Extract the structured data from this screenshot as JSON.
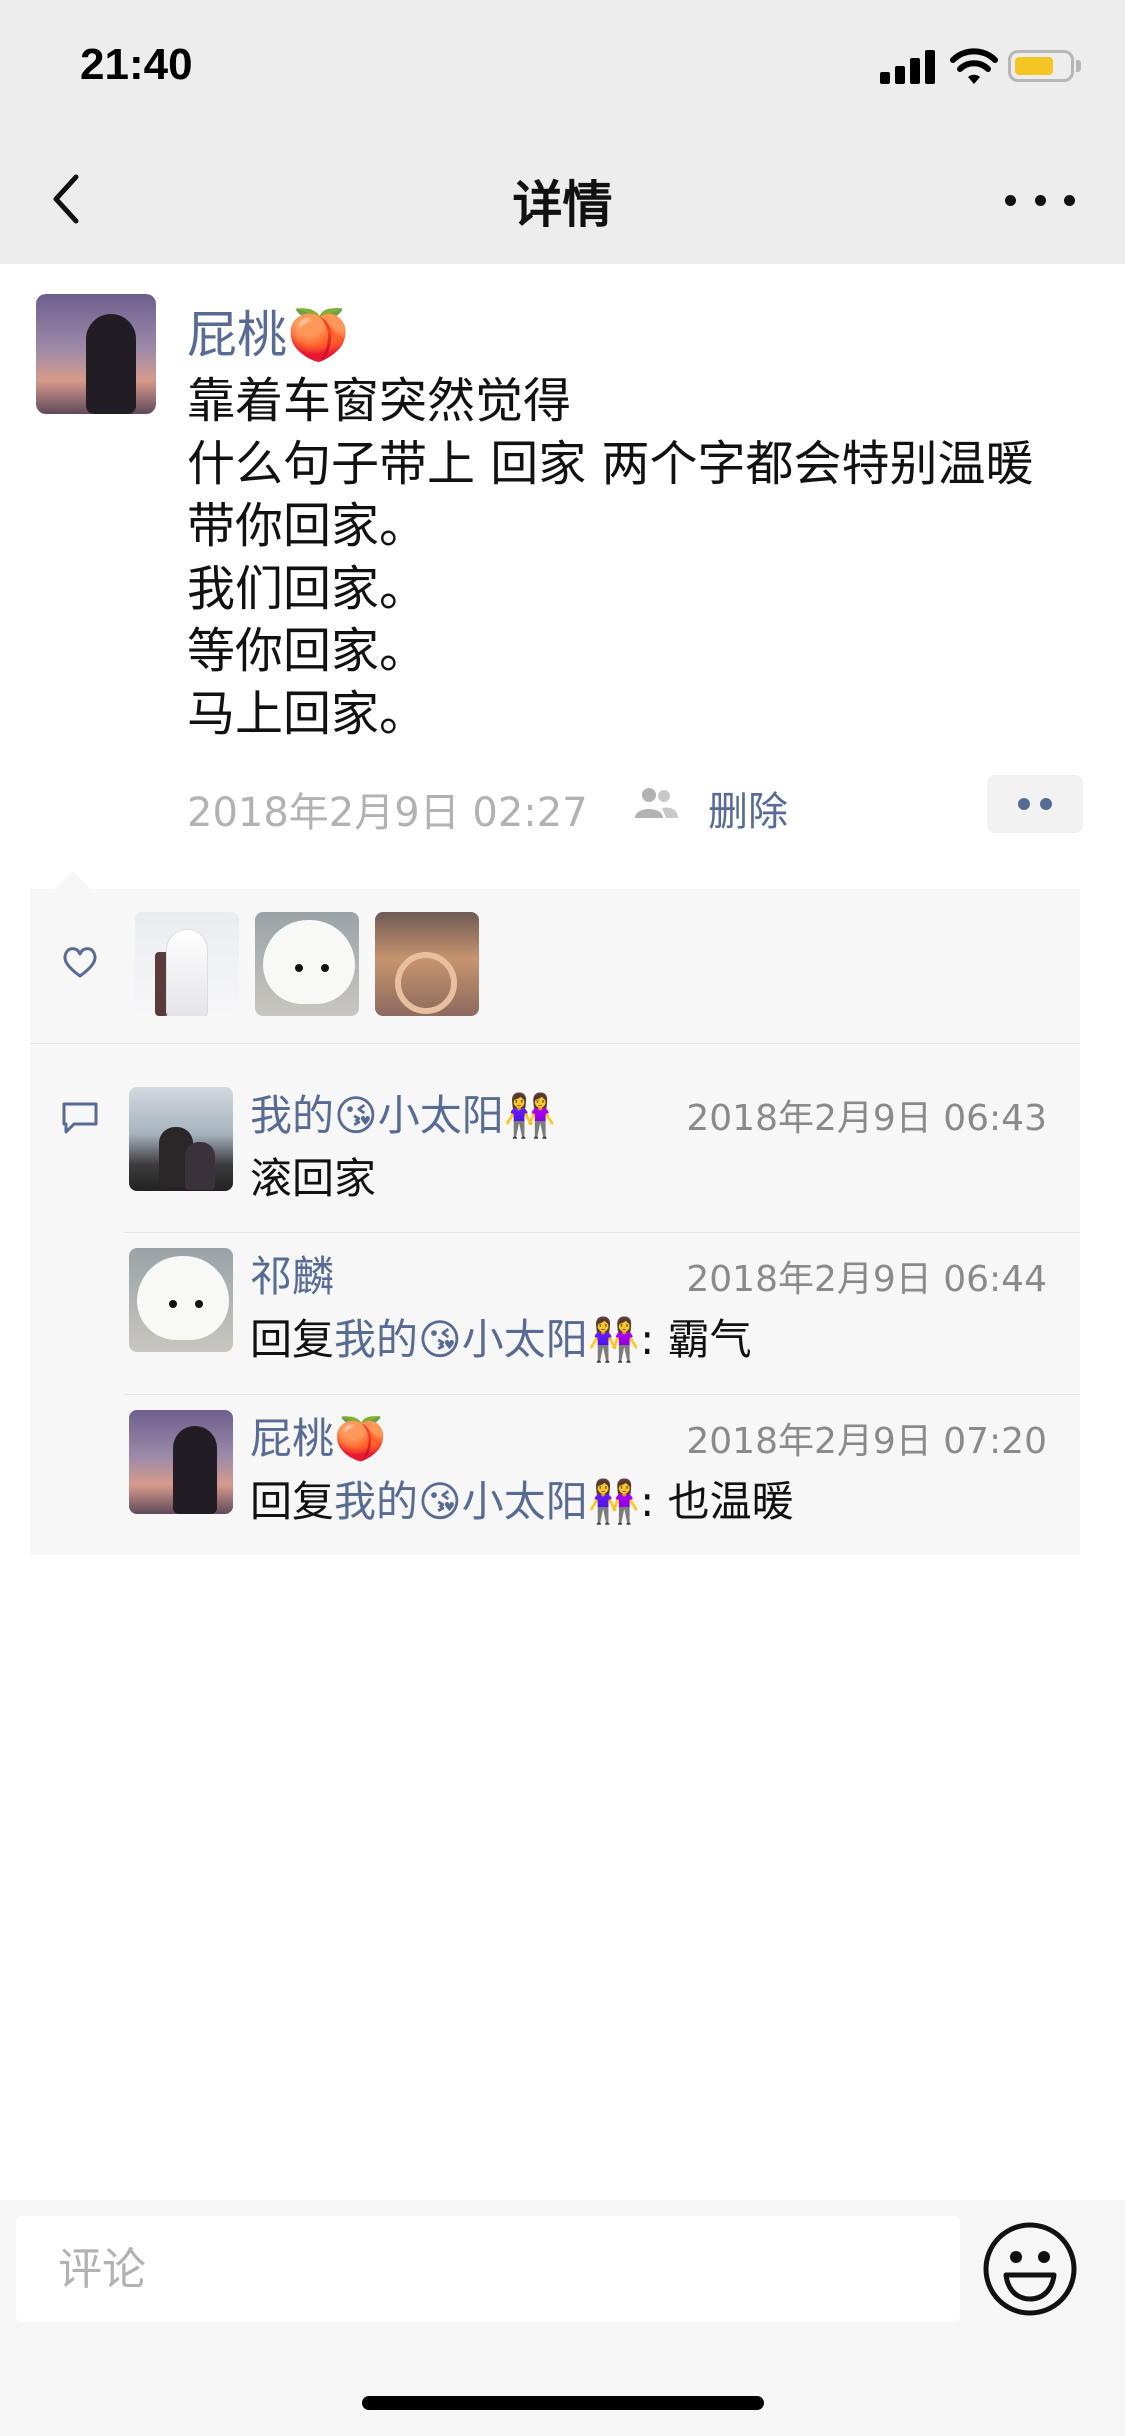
{
  "status_bar": {
    "time": "21:40"
  },
  "nav": {
    "title": "详情"
  },
  "post": {
    "author": "屁桃🍑",
    "lines": [
      "靠着车窗突然觉得",
      "什么句子带上 回家 两个字都会特别温暖",
      "带你回家。",
      "我们回家。",
      "等你回家。",
      "马上回家。"
    ],
    "timestamp": "2018年2月9日 02:27",
    "delete_label": "删除"
  },
  "comments": [
    {
      "author": "我的😘小太阳👭",
      "time": "2018年2月9日 06:43",
      "text": "滚回家",
      "reply_prefix": "",
      "reply_to": "",
      "reply_sep": ""
    },
    {
      "author": "祁麟",
      "time": "2018年2月9日 06:44",
      "text": "霸气",
      "reply_prefix": "回复",
      "reply_to": "我的😘小太阳👭",
      "reply_sep": ": "
    },
    {
      "author": "屁桃🍑",
      "time": "2018年2月9日 07:20",
      "text": "也温暖",
      "reply_prefix": "回复",
      "reply_to": "我的😘小太阳👭",
      "reply_sep": ": "
    }
  ],
  "input": {
    "placeholder": "评论"
  },
  "icons": {
    "back": "chevron-left-icon",
    "more": "ellipsis-icon",
    "like": "heart-icon",
    "comment": "speech-bubble-icon",
    "visibility": "people-icon",
    "emoji": "smiley-icon"
  },
  "colors": {
    "link": "#576b95",
    "nav_background": "#ededed",
    "interaction_background": "#f7f7f7",
    "battery": "#f3c623"
  }
}
